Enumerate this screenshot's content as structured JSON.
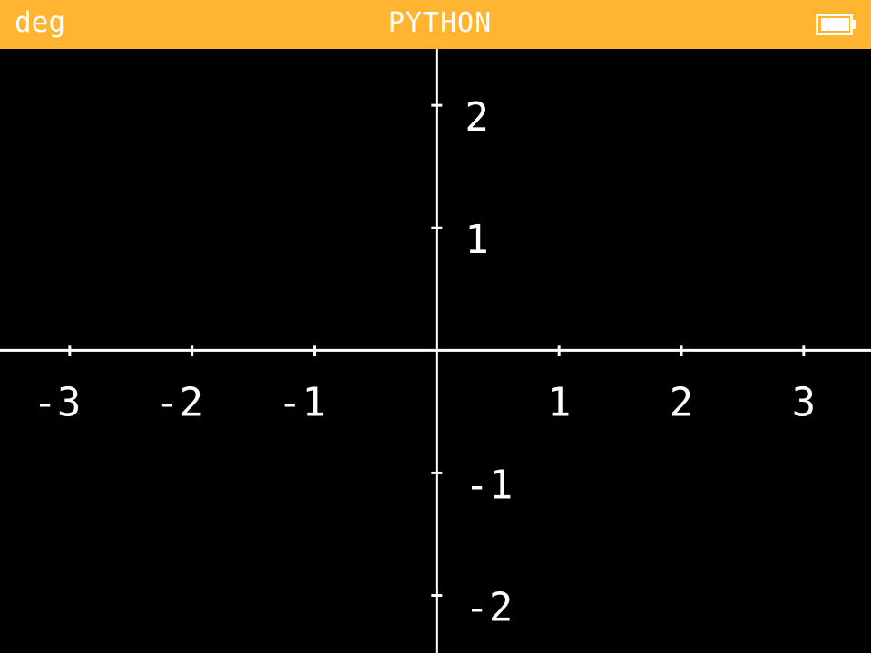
{
  "status_bar": {
    "angle_mode": "deg",
    "title": "PYTHON",
    "battery_icon": "battery-full-icon",
    "background_color": "#ffb531",
    "text_color": "#ffffff"
  },
  "plot": {
    "background_color": "#000000",
    "axis_color": "#ffffff",
    "x_ticks": [
      -3,
      -2,
      -1,
      1,
      2,
      3
    ],
    "y_ticks": [
      2,
      1,
      -1,
      -2
    ],
    "x_tick_labels": [
      "-3",
      "-2",
      "-1",
      "1",
      "2",
      "3"
    ],
    "y_tick_labels": [
      "2",
      "1",
      "-1",
      "-2"
    ],
    "xlim": [
      -3.57,
      3.55
    ],
    "ylim": [
      -2.47,
      2.46
    ]
  }
}
